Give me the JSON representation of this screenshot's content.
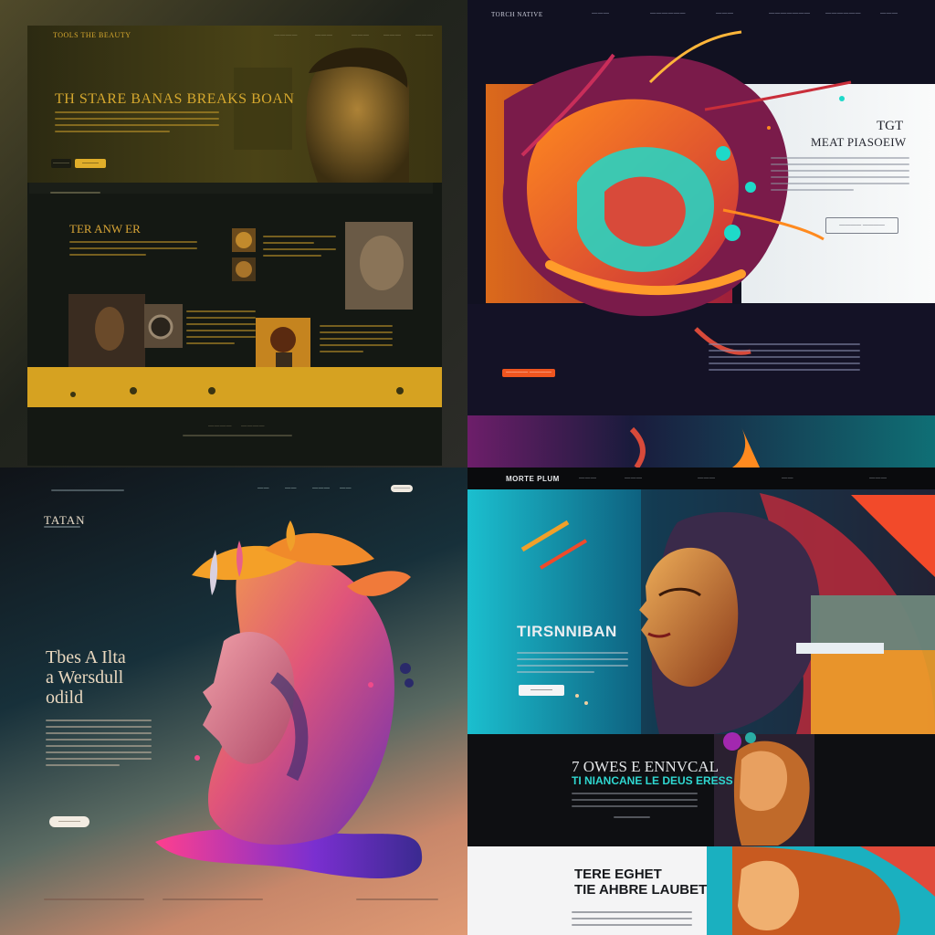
{
  "panel1": {
    "logo": "TOOLS THE BEAUTY",
    "nav": [
      "————",
      "———",
      "———",
      "———",
      "———"
    ],
    "hero_title": "TH STARE BANAS BREAKS BOAN",
    "hero_cta_left": "———",
    "hero_cta_right": "———",
    "section_title": "TER ANW ER",
    "footer_links": [
      "————",
      "————"
    ],
    "colors": {
      "accent": "#d6a82e",
      "bg": "#141813",
      "band": "#d6a221"
    }
  },
  "panel2": {
    "logo": "TORCH NATIVE",
    "nav": [
      "———",
      "——————",
      "———",
      "———————",
      "——————",
      "———"
    ],
    "title_top": "TGT",
    "title_main": "MEAT PIASOEIW",
    "cta_outline": "———— ————",
    "cta_orange": "———— ————",
    "colors": {
      "accent": "#f0551f",
      "teal": "#1ed9c9",
      "dark": "#111121"
    }
  },
  "panel3": {
    "logo": "TATAN",
    "nav": [
      "——",
      "——",
      "———",
      "——"
    ],
    "nav_pill": "———",
    "headline_1": "Tbes A Ilta",
    "headline_2": "a Wersdull",
    "headline_3": "odild",
    "cta": "————",
    "colors": {
      "text": "#ead8bf",
      "pill": "#efe9df"
    }
  },
  "panel4": {
    "logo": "MORTE PLUM",
    "nav": [
      "———",
      "———",
      "———",
      "——",
      "———"
    ],
    "hero_title": "TIRSNNIBAN",
    "hero_cta": "————",
    "section_title_1": "7 OWES E ENNVCAL",
    "section_title_2": "TI NIANCANE LE DEUS ERESS",
    "bottom_title_1": "TERE EGHET",
    "bottom_title_2": "TIE AHBRE LAUBET",
    "colors": {
      "teal": "#2fd7d0",
      "dark": "#0e0f12",
      "light": "#f4f4f5"
    }
  }
}
